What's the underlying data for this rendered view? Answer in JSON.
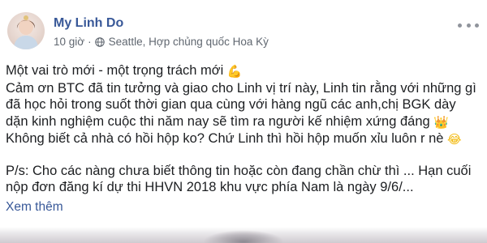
{
  "post": {
    "author": "My Linh Do",
    "time": "10 giờ",
    "separator": "·",
    "location": "Seattle, Hợp chủng quốc Hoa Kỳ",
    "privacy_icon": "globe-icon",
    "more_icon": "more-options-icon",
    "lines": [
      "Một vai trò mới - một trọng trách mới",
      "Cảm ơn BTC đã tin tưởng và giao cho Linh vị trí này, Linh tin rằng với những gì",
      "đã học hỏi trong suốt thời gian qua cùng với hàng ngũ các anh,chị BGK dày",
      "dặn kinh nghiệm cuộc thi năm nay sẽ tìm ra người kế nhiệm xứng đáng",
      "Không biết cả nhà có hồi hộp ko? Chứ Linh thì hồi hộp muốn xỉu luôn r nè",
      "P/s: Cho các nàng chưa biết thông tin hoặc còn đang chần chừ thì ... Hạn cuối",
      "nộp đơn đăng kí dự thi HHVN 2018 khu vực phía Nam là ngày 9/6/..."
    ],
    "emoji": {
      "muscle": "💪",
      "crown": "👑",
      "laugh": "😂"
    },
    "see_more": "Xem thêm"
  },
  "colors": {
    "author": "#385898",
    "meta": "#606770",
    "text": "#1c1e21",
    "link": "#385898"
  }
}
